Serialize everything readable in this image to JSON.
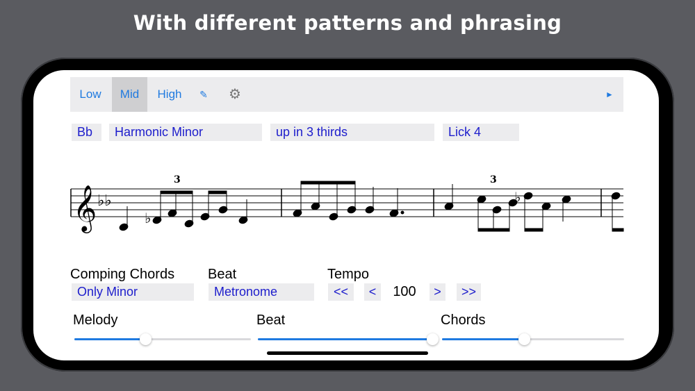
{
  "headline": "With different patterns and phrasing",
  "toolbar": {
    "low": "Low",
    "mid": "Mid",
    "high": "High",
    "edit_glyph": "✎",
    "settings_glyph": "⚙",
    "play_glyph": "►",
    "selected": "Mid"
  },
  "selectors": {
    "key": "Bb",
    "scale": "Harmonic Minor",
    "pattern": "up in 3 thirds",
    "lick": "Lick 4"
  },
  "notation": {
    "clef": "𝄞",
    "key_signature": "♭♭",
    "triplet_1": "3",
    "triplet_2": "3",
    "accidental_1": "♭",
    "accidental_2": "♭"
  },
  "comping": {
    "label": "Comping Chords",
    "value": "Only Minor"
  },
  "beat": {
    "label": "Beat",
    "value": "Metronome"
  },
  "tempo": {
    "label": "Tempo",
    "value": "100",
    "fast_back": "<<",
    "back": "<",
    "fwd": ">",
    "fast_fwd": ">>"
  },
  "mixer": {
    "melody": {
      "label": "Melody",
      "level": 0.4
    },
    "beat": {
      "label": "Beat",
      "level": 0.98
    },
    "chords": {
      "label": "Chords",
      "level": 0.45
    }
  },
  "colors": {
    "accent": "#1f7ae0",
    "link_text": "#1d1dcc",
    "panel": "#ececee"
  }
}
